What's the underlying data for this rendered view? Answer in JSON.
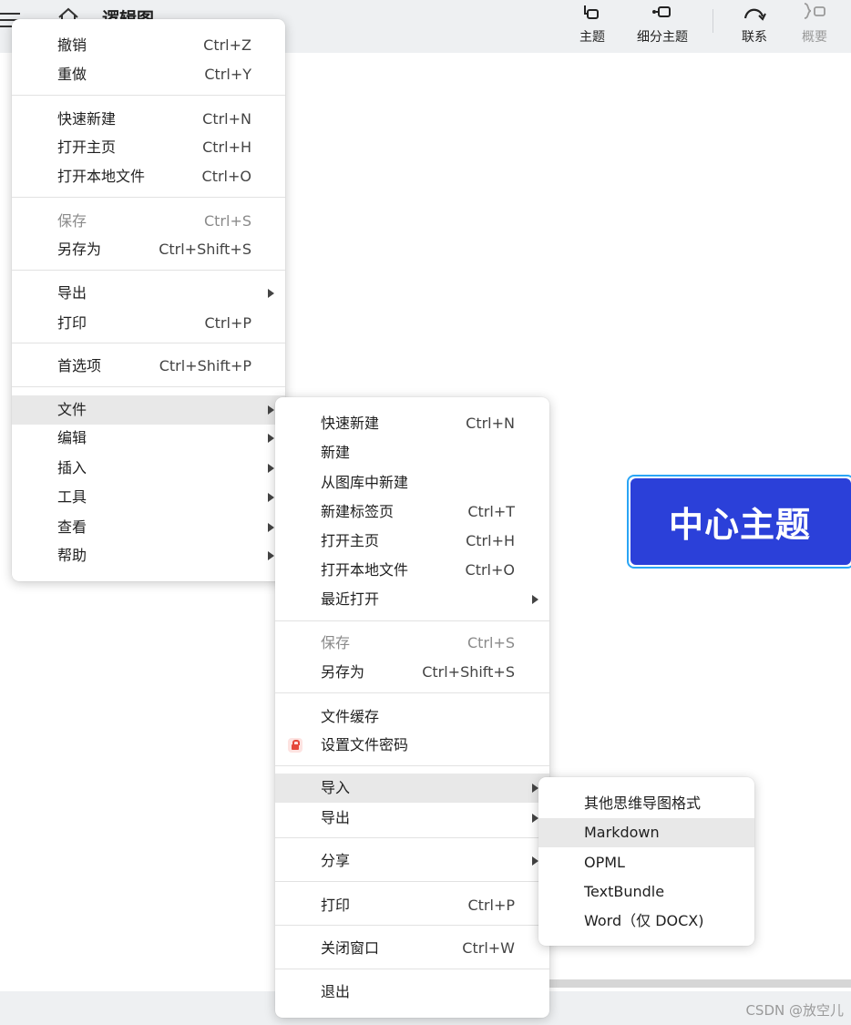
{
  "header": {
    "title": "逻辑图",
    "tools": [
      {
        "label": "主题",
        "icon": "topic-icon"
      },
      {
        "label": "细分主题",
        "icon": "subtopic-icon"
      },
      {
        "label": "联系",
        "icon": "relationship-icon"
      },
      {
        "label": "概要",
        "icon": "summary-icon",
        "disabled": true
      }
    ]
  },
  "canvas": {
    "center_topic": "中心主题",
    "center_topic_color": "#2b40d9",
    "selection_border_color": "#2aa5f5"
  },
  "main_menu": {
    "items": [
      {
        "label": "撤销",
        "shortcut": "Ctrl+Z"
      },
      {
        "label": "重做",
        "shortcut": "Ctrl+Y"
      },
      {
        "label": "快速新建",
        "shortcut": "Ctrl+N"
      },
      {
        "label": "打开主页",
        "shortcut": "Ctrl+H"
      },
      {
        "label": "打开本地文件",
        "shortcut": "Ctrl+O"
      },
      {
        "label": "保存",
        "shortcut": "Ctrl+S",
        "disabled": true
      },
      {
        "label": "另存为",
        "shortcut": "Ctrl+Shift+S"
      },
      {
        "label": "导出",
        "submenu": true
      },
      {
        "label": "打印",
        "shortcut": "Ctrl+P"
      },
      {
        "label": "首选项",
        "shortcut": "Ctrl+Shift+P"
      },
      {
        "label": "文件",
        "submenu": true,
        "highlighted": true
      },
      {
        "label": "编辑",
        "submenu": true
      },
      {
        "label": "插入",
        "submenu": true
      },
      {
        "label": "工具",
        "submenu": true
      },
      {
        "label": "查看",
        "submenu": true
      },
      {
        "label": "帮助",
        "submenu": true
      }
    ]
  },
  "file_menu": {
    "items": [
      {
        "label": "快速新建",
        "shortcut": "Ctrl+N"
      },
      {
        "label": "新建"
      },
      {
        "label": "从图库中新建"
      },
      {
        "label": "新建标签页",
        "shortcut": "Ctrl+T"
      },
      {
        "label": "打开主页",
        "shortcut": "Ctrl+H"
      },
      {
        "label": "打开本地文件",
        "shortcut": "Ctrl+O"
      },
      {
        "label": "最近打开",
        "submenu": true
      },
      {
        "label": "保存",
        "shortcut": "Ctrl+S",
        "disabled": true
      },
      {
        "label": "另存为",
        "shortcut": "Ctrl+Shift+S"
      },
      {
        "label": "文件缓存"
      },
      {
        "label": "设置文件密码",
        "icon": "lock-icon"
      },
      {
        "label": "导入",
        "submenu": true,
        "highlighted": true
      },
      {
        "label": "导出",
        "submenu": true
      },
      {
        "label": "分享",
        "submenu": true
      },
      {
        "label": "打印",
        "shortcut": "Ctrl+P"
      },
      {
        "label": "关闭窗口",
        "shortcut": "Ctrl+W"
      },
      {
        "label": "退出"
      }
    ]
  },
  "import_menu": {
    "items": [
      {
        "label": "其他思维导图格式"
      },
      {
        "label": "Markdown",
        "highlighted": true
      },
      {
        "label": "OPML"
      },
      {
        "label": "TextBundle"
      },
      {
        "label": "Word（仅 DOCX)"
      }
    ]
  },
  "watermark": "CSDN @放空儿"
}
